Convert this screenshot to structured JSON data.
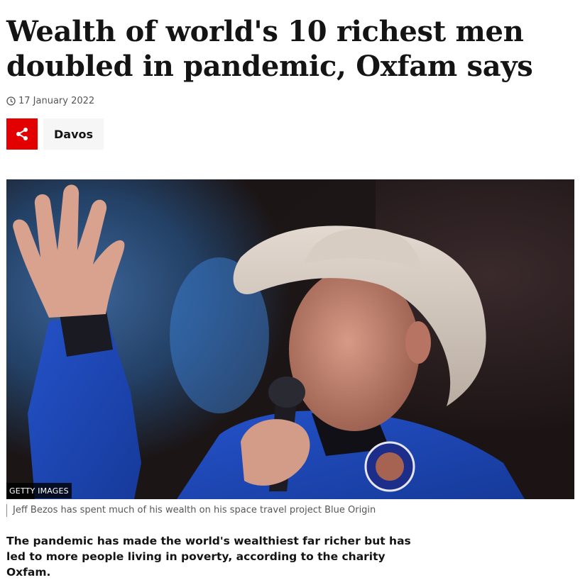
{
  "article": {
    "headline": "Wealth of world's 10 richest men doubled in pandemic, Oxfam says",
    "date": "17 January 2022",
    "share_icon": "share-icon",
    "topic_tag": "Davos",
    "image": {
      "credit": "GETTY IMAGES",
      "caption": "Jeff Bezos has spent much of his wealth on his space travel project Blue Origin"
    },
    "lead": "The pandemic has made the world's wealthiest far richer but has led to more people living in poverty, according to the charity Oxfam."
  },
  "colors": {
    "share_button": "#e20000",
    "tag_background": "#f6f6f6",
    "text": "#141414",
    "muted_text": "#545658"
  }
}
